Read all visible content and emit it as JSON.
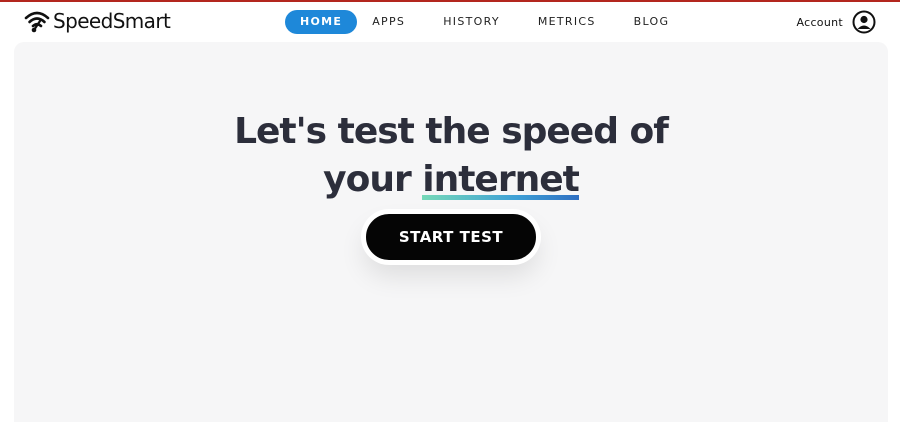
{
  "brand": {
    "name": "SpeedSmart"
  },
  "nav": {
    "items": [
      {
        "label": "HOME",
        "active": true
      },
      {
        "label": "APPS",
        "active": false
      },
      {
        "label": "HISTORY",
        "active": false
      },
      {
        "label": "METRICS",
        "active": false
      },
      {
        "label": "BLOG",
        "active": false
      }
    ]
  },
  "account": {
    "label": "Account",
    "icon": "user-circle-icon"
  },
  "hero": {
    "headline_line1": "Let's test the speed of",
    "headline_line2_prefix": "your ",
    "headline_line2_highlight": "internet",
    "start_button": "START TEST"
  },
  "colors": {
    "accent": "#1e88d9",
    "headline": "#2c2e3b",
    "button": "#050505",
    "background": "#f6f6f7",
    "top_border": "#b3261e"
  }
}
